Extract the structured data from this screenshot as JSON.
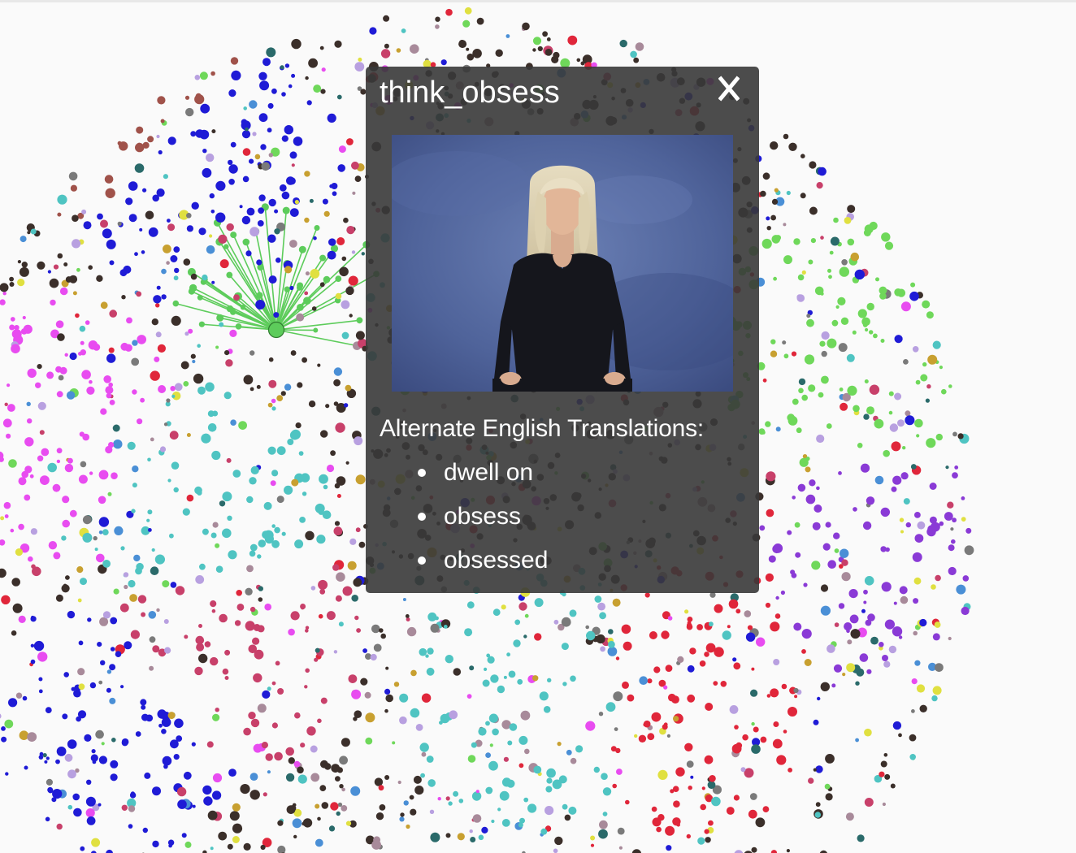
{
  "popup": {
    "title": "think_obsess",
    "close_label": "X",
    "translations_heading": "Alternate English Translations:",
    "translations": [
      "dwell on",
      "obsess",
      "obsessed"
    ],
    "colors": {
      "background": "#383838",
      "text": "#ffffff"
    }
  },
  "graph": {
    "background": "#fafafa",
    "highlight_color": "#5dcc5b",
    "palette": [
      "#3b2f2a",
      "#1f1bd6",
      "#4fc4c2",
      "#e0263a",
      "#c8406a",
      "#e84cf0",
      "#6fd85a",
      "#4a8fd6",
      "#a88a9a",
      "#b8a0e0",
      "#c8a030",
      "#2a6a6a",
      "#7a7a7a",
      "#e0e040"
    ]
  }
}
